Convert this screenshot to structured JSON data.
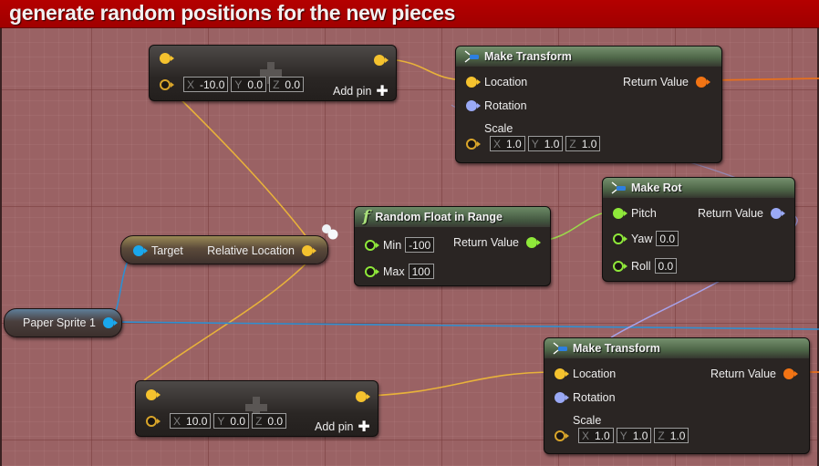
{
  "comment": {
    "title": "generate random positions for the new pieces"
  },
  "colors": {
    "vector_pin": "#f5c22e",
    "rotator_pin": "#9aa9f5",
    "float_pin": "#8fe83a",
    "transform_pin": "#f27414",
    "object_pin": "#1aa7ec",
    "comment_bg": "#a60000",
    "canvas_bg": "#9a6264"
  },
  "nodes": {
    "add_top": {
      "pins": [
        {
          "axis": "X",
          "value": "-10.0"
        },
        {
          "axis": "Y",
          "value": "0.0"
        },
        {
          "axis": "Z",
          "value": "0.0"
        }
      ],
      "add_pin_label": "Add pin",
      "add_pin_icon": "plus-icon"
    },
    "add_bottom": {
      "pins": [
        {
          "axis": "X",
          "value": "10.0"
        },
        {
          "axis": "Y",
          "value": "0.0"
        },
        {
          "axis": "Z",
          "value": "0.0"
        }
      ],
      "add_pin_label": "Add pin",
      "add_pin_icon": "plus-icon"
    },
    "make_transform_top": {
      "title": "Make Transform",
      "icon": "struct-make-icon",
      "location_label": "Location",
      "rotation_label": "Rotation",
      "scale_label": "Scale",
      "scale": [
        {
          "axis": "X",
          "value": "1.0"
        },
        {
          "axis": "Y",
          "value": "1.0"
        },
        {
          "axis": "Z",
          "value": "1.0"
        }
      ],
      "return_label": "Return Value"
    },
    "make_transform_bottom": {
      "title": "Make Transform",
      "icon": "struct-make-icon",
      "location_label": "Location",
      "rotation_label": "Rotation",
      "scale_label": "Scale",
      "scale": [
        {
          "axis": "X",
          "value": "1.0"
        },
        {
          "axis": "Y",
          "value": "1.0"
        },
        {
          "axis": "Z",
          "value": "1.0"
        }
      ],
      "return_label": "Return Value"
    },
    "make_rot": {
      "title": "Make Rot",
      "icon": "struct-make-icon",
      "pitch_label": "Pitch",
      "yaw_label": "Yaw",
      "yaw_value": "0.0",
      "roll_label": "Roll",
      "roll_value": "0.0",
      "return_label": "Return Value"
    },
    "random_float": {
      "title": "Random Float in Range",
      "icon": "function-icon",
      "icon_glyph": "f",
      "min_label": "Min",
      "min_value": "-100",
      "max_label": "Max",
      "max_value": "100",
      "return_label": "Return Value"
    },
    "get_relative_location": {
      "target_label": "Target",
      "return_label": "Relative Location"
    },
    "paper_sprite": {
      "label": "Paper Sprite 1"
    }
  }
}
